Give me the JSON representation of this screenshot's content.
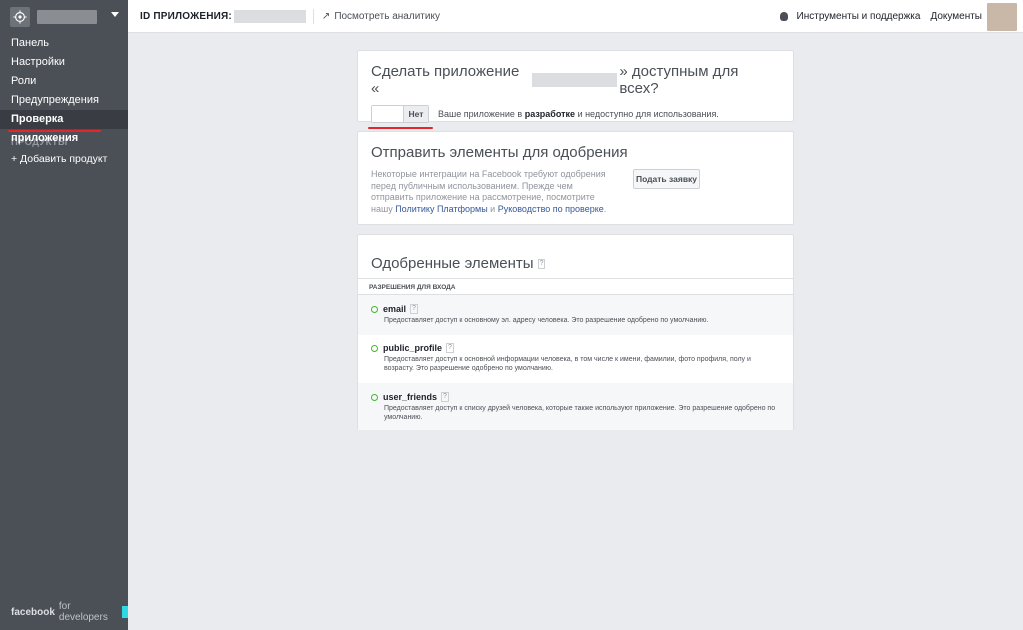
{
  "sidebar": {
    "items": [
      {
        "label": "Панель"
      },
      {
        "label": "Настройки"
      },
      {
        "label": "Роли"
      },
      {
        "label": "Предупреждения"
      },
      {
        "label": "Проверка приложения",
        "active": true
      }
    ],
    "section_label": "ПРОДУКТЫ",
    "add_product": "+ Добавить продукт",
    "footer_brand": "facebook",
    "footer_tag": "for developers"
  },
  "topbar": {
    "app_id_label": "ID ПРИЛОЖЕНИЯ:",
    "analytics_label": "Посмотреть аналитику",
    "tools_label": "Инструменты и поддержка",
    "docs_label": "Документы"
  },
  "make_public": {
    "title_prefix": "Сделать приложение «",
    "title_suffix": "» доступным для всех?",
    "toggle_label": "Нет",
    "status_prefix": "Ваше приложение в ",
    "status_bold": "разработке",
    "status_suffix": " и недоступно для использования."
  },
  "submit": {
    "title": "Отправить элементы для одобрения",
    "desc_prefix": "Некоторые интеграции на Facebook требуют одобрения перед публичным использованием. Прежде чем отправить приложение на рассмотрение, посмотрите нашу ",
    "policy_link": "Политику Платформы",
    "desc_and": " и ",
    "guide_link": "Руководство по проверке",
    "desc_end": ".",
    "button_label": "Подать заявку"
  },
  "approved": {
    "title": "Одобренные элементы",
    "help": "?",
    "section_label": "РАЗРЕШЕНИЯ ДЛЯ ВХОДА",
    "permissions": [
      {
        "name": "email",
        "help": "?",
        "desc": "Предоставляет доступ к основному эл. адресу человека. Это разрешение одобрено по умолчанию."
      },
      {
        "name": "public_profile",
        "help": "?",
        "desc": "Предоставляет доступ к основной информации человека, в том числе к имени, фамилии, фото профиля, полу и возрасту. Это разрешение одобрено по умолчанию."
      },
      {
        "name": "user_friends",
        "help": "?",
        "desc": "Предоставляет доступ к списку друзей человека, которые также используют приложение. Это разрешение одобрено по умолчанию."
      }
    ]
  },
  "colors": {
    "sidebar_bg": "#4b4f56",
    "active_bg": "#393c42",
    "highlight_red": "#e2262b",
    "approved_green": "#42b72a",
    "link_blue": "#365899"
  }
}
